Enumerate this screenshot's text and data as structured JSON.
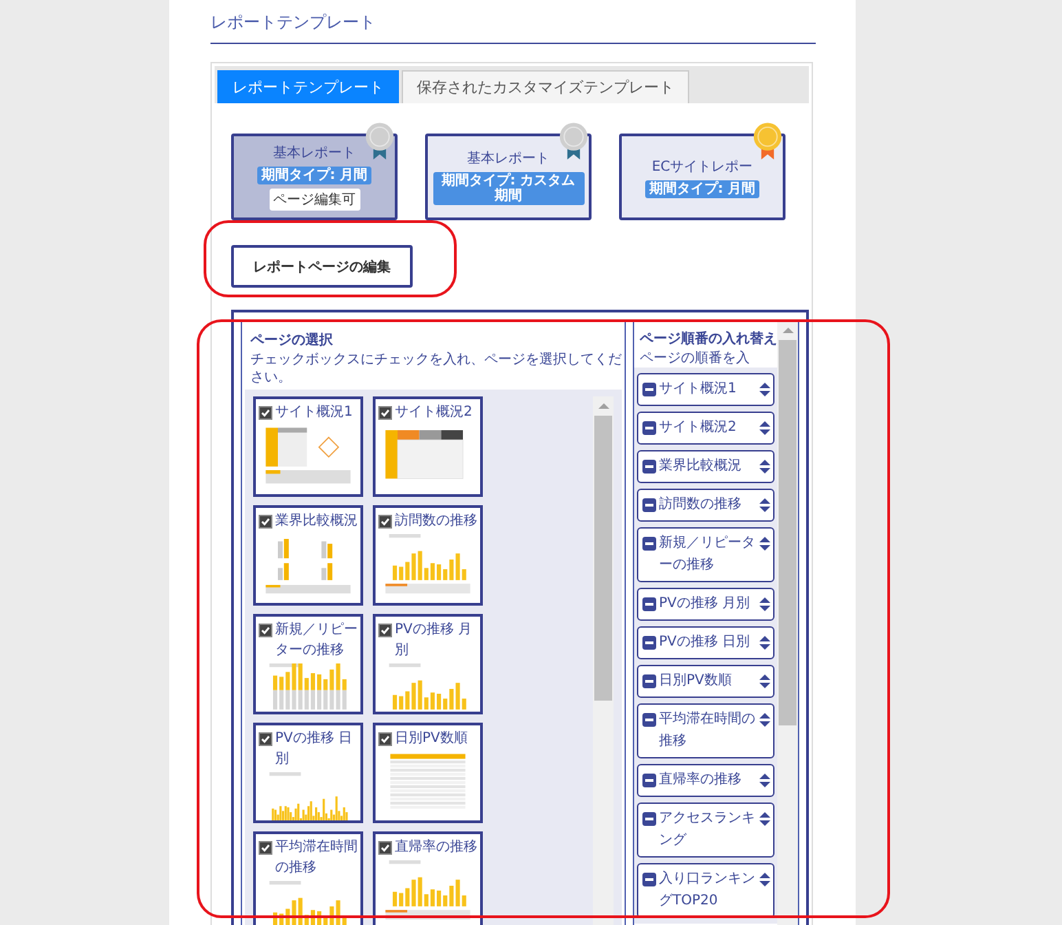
{
  "heading": "レポートテンプレート",
  "tabs": [
    {
      "label": "レポートテンプレート",
      "selected": true
    },
    {
      "label": "保存されたカスタマイズテンプレート",
      "selected": false
    }
  ],
  "templates": [
    {
      "title": "基本レポート",
      "kind": "silver",
      "period": "期間タイプ: 月間",
      "editable_tag": "ページ編集可",
      "selected": true
    },
    {
      "title": "基本レポート",
      "kind": "silver",
      "period": "期間タイプ: カスタム期間",
      "selected": false
    },
    {
      "title": "ECサイトレポー",
      "kind": "gold",
      "period": "期間タイプ: 月間",
      "selected": false
    }
  ],
  "edit_button": "レポートページの編集",
  "page_select": {
    "title": "ページの選択",
    "description": "チェックボックスにチェックを入れ、ページを選択してください。",
    "pages": [
      {
        "label": "サイト概況1",
        "checked": true,
        "kind": "summary"
      },
      {
        "label": "サイト概況2",
        "checked": true,
        "kind": "table"
      },
      {
        "label": "業界比較概況",
        "checked": true,
        "kind": "quad"
      },
      {
        "label": "訪問数の推移",
        "checked": true,
        "kind": "bar"
      },
      {
        "label": "新規／リピーターの推移",
        "checked": true,
        "kind": "stacked"
      },
      {
        "label": "PVの推移 月別",
        "checked": true,
        "kind": "bar"
      },
      {
        "label": "PVの推移 日別",
        "checked": true,
        "kind": "dense"
      },
      {
        "label": "日別PV数順",
        "checked": true,
        "kind": "list"
      },
      {
        "label": "平均滞在時間の推移",
        "checked": true,
        "kind": "bar"
      },
      {
        "label": "直帰率の推移",
        "checked": true,
        "kind": "bar"
      }
    ]
  },
  "page_order": {
    "title": "ページ順番の入れ替え",
    "description": "ページの順番を入",
    "items": [
      "サイト概況1",
      "サイト概況2",
      "業界比較概況",
      "訪問数の推移",
      "新規／リピーターの推移",
      "PVの推移 月別",
      "PVの推移 日別",
      "日別PV数順",
      "平均滞在時間の推移",
      "直帰率の推移",
      "アクセスランキング",
      "入り口ランキングTOP20"
    ]
  }
}
